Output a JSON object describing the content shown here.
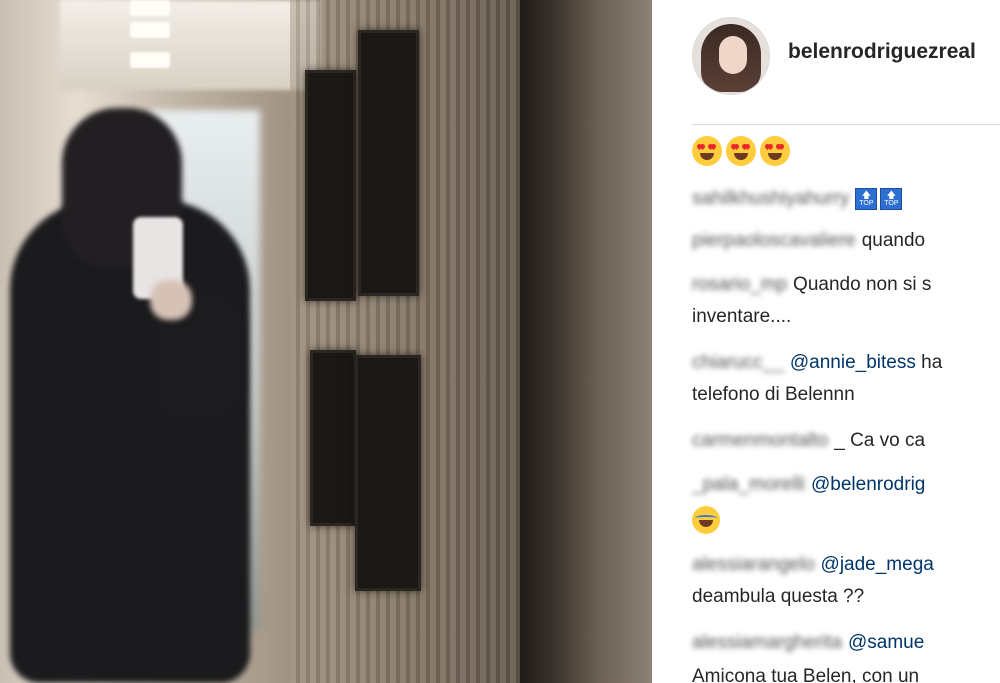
{
  "post": {
    "username": "belenrodriguezreal",
    "emoji_row": [
      "heart-eyes",
      "heart-eyes",
      "heart-eyes"
    ]
  },
  "comments": [
    {
      "user": "sahilkhushiyahurry",
      "text": "",
      "badges": [
        "TOP",
        "TOP"
      ]
    },
    {
      "user": "pierpaoloscavaliere",
      "text": "quando"
    },
    {
      "user": "rosario_mp",
      "text": "Quando non si s",
      "cont": "inventare...."
    },
    {
      "user": "chiarucc__",
      "mention": "@annie_bitess",
      "text": " ha",
      "cont": "telefono di Belennn"
    },
    {
      "user": "carmenmontalto",
      "text": "_ Ca vo ca"
    },
    {
      "user": "_pala_morelli",
      "mention": "@belenrodrig",
      "cont_emoji": "laughing-tears"
    },
    {
      "user": "alessiarangelo",
      "mention": "@jade_mega",
      "cont": "deambula questa ??"
    },
    {
      "user": "alessiamargherita",
      "mention": "@samue",
      "cont": "Amicona tua Belen, con un"
    }
  ],
  "badge_text": "TOP",
  "colors": {
    "mention": "#003569",
    "text": "#262626",
    "divider": "#dbdbdb"
  }
}
